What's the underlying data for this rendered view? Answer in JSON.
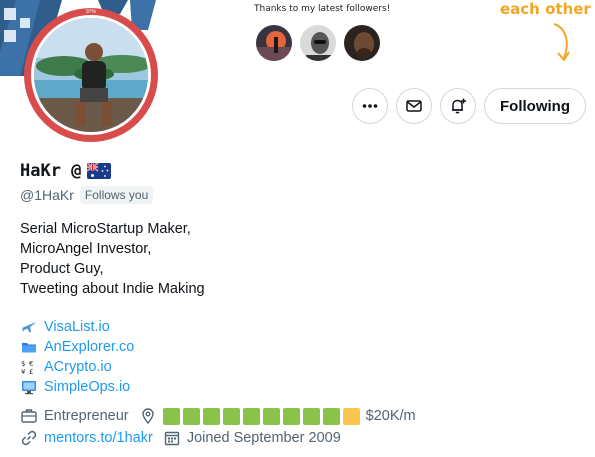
{
  "banner": {
    "thanks_text": "Thanks to my latest followers!",
    "each_other_text": "each other",
    "avatar_progress_text": "97%",
    "accent_color": "#f2a623",
    "follower_avatars": [
      "follower-avatar-1",
      "follower-avatar-2",
      "follower-avatar-3"
    ]
  },
  "actions": {
    "more_icon": "more-dots-icon",
    "message_icon": "mail-icon",
    "notify_icon": "bell-plus-icon",
    "following_label": "Following"
  },
  "profile": {
    "display_name": "HaKr @",
    "flag_icon": "australia-flag-icon",
    "handle": "@1HaKr",
    "follows_you_label": "Follows you",
    "avatar_ring_color": "#d84c4c"
  },
  "bio": {
    "lines": [
      "Serial MicroStartup Maker,",
      "MicroAngel Investor,",
      "Product Guy,",
      "Tweeting about Indie Making"
    ]
  },
  "links": [
    {
      "icon": "airplane-icon",
      "text": "VisaList.io"
    },
    {
      "icon": "folder-icon",
      "text": "AnExplorer.co"
    },
    {
      "icon": "currency-exchange-icon",
      "text": "ACrypto.io"
    },
    {
      "icon": "computer-icon",
      "text": "SimpleOps.io"
    }
  ],
  "meta": {
    "profession": "Entrepreneur",
    "location_icon": "location-pin-icon",
    "progress_squares": {
      "filled_green": 9,
      "filled_yellow": 1,
      "green_color": "#8bc34a",
      "yellow_color": "#f9c74f"
    },
    "revenue": "$20K/m",
    "website": "mentors.to/1hakr",
    "joined": "Joined September 2009"
  },
  "colors": {
    "link": "#1d9bf0",
    "secondary_text": "#536471",
    "border": "#cfd9de"
  }
}
